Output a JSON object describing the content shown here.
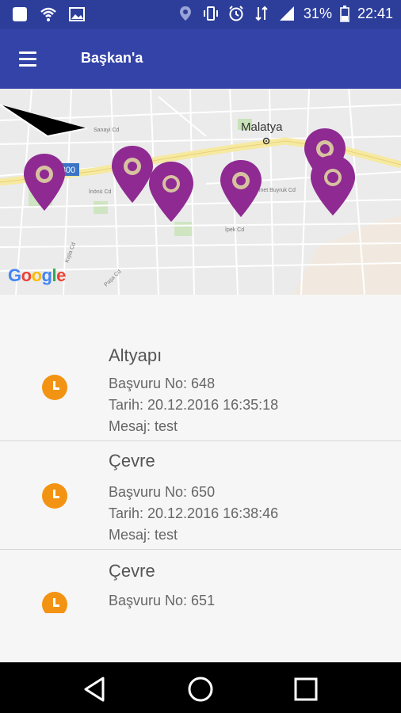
{
  "status_bar": {
    "battery": "31%",
    "time": "22:41",
    "icons": [
      "notification-square-icon",
      "wifi-question-icon",
      "image-icon",
      "location-icon",
      "vibrate-icon",
      "alarm-icon",
      "data-transfer-icon",
      "signal-icon",
      "battery-icon"
    ]
  },
  "app_bar": {
    "title": "Başkan'a",
    "menu_icon": "hamburger-menu-icon"
  },
  "map": {
    "city_label": "Malatya",
    "street_labels": [
      "Sanayi Cd",
      "İnönü Cd",
      "Ahmet Buyruk Cd",
      "İpek Cd",
      "Kışla Cd",
      "Paşa Cd"
    ],
    "road_shield": "300",
    "logo": "Google",
    "pin_color": "#8e2a92"
  },
  "applications": [
    {
      "category": "Altyapı",
      "number": "Başvuru No: 648",
      "date": "Tarih: 20.12.2016 16:35:18",
      "message": "Mesaj: test",
      "status_icon": "clock-icon"
    },
    {
      "category": "Çevre",
      "number": "Başvuru No: 650",
      "date": "Tarih: 20.12.2016 16:38:46",
      "message": "Mesaj: test",
      "status_icon": "clock-icon"
    },
    {
      "category": "Çevre",
      "number": "Başvuru No: 651",
      "status_icon": "clock-icon"
    }
  ],
  "nav_bar": {
    "icons": [
      "back-icon",
      "home-icon",
      "recents-icon"
    ]
  },
  "colors": {
    "status_bar": "#2c3e9a",
    "app_bar": "#3443a8",
    "status_pending": "#f39313",
    "pin": "#8e2a92"
  }
}
